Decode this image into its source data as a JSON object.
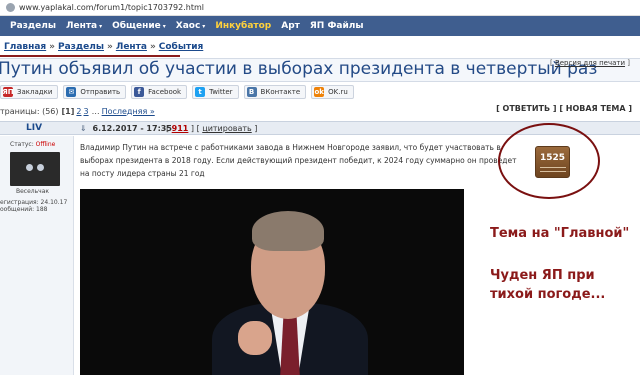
{
  "browser": {
    "url": "www.yaplakal.com/forum1/topic1703792.html"
  },
  "topnav": {
    "items": [
      "Разделы",
      "Лента",
      "Общение",
      "Хаос",
      "Инкубатор",
      "Арт",
      "ЯП Файлы"
    ],
    "dropdown_marker": "▾",
    "accent_color": "#3f5e8f",
    "highlight_color": "#ffd23c"
  },
  "breadcrumb": {
    "items": [
      "Главная",
      "Разделы",
      "Лента",
      "События"
    ],
    "separator": "»"
  },
  "topic": {
    "title": "Путин объявил об участии в выборах президента в четвертый раз",
    "print_link": "Версия для печати"
  },
  "social": [
    {
      "label": "Закладки",
      "icon": "yap-icon",
      "icon_text": "ЯП",
      "color": "#c62828"
    },
    {
      "label": "Отправить",
      "icon": "mail-icon",
      "icon_text": "✉",
      "color": "#2b6cb0"
    },
    {
      "label": "Facebook",
      "icon": "facebook-icon",
      "icon_text": "f",
      "color": "#3b5998"
    },
    {
      "label": "Twitter",
      "icon": "twitter-icon",
      "icon_text": "t",
      "color": "#1da1f2"
    },
    {
      "label": "ВКонтакте",
      "icon": "vk-icon",
      "icon_text": "B",
      "color": "#4a76a8"
    },
    {
      "label": "OK.ru",
      "icon": "ok-icon",
      "icon_text": "ok",
      "color": "#ee8208"
    }
  ],
  "pagination": {
    "prefix": "траницы: (56)",
    "current": "[1]",
    "pages": [
      "2",
      "3"
    ],
    "last": "Последняя »"
  },
  "actions": {
    "reply": "[ ОТВЕТИТЬ ]",
    "new_topic": "[ НОВАЯ ТЕМА ]"
  },
  "post": {
    "author": "LIV",
    "date": "6.12.2017 - 17:35",
    "votes": "911",
    "quote": "цитировать",
    "status_label": "Статус:",
    "status_value": "Offline",
    "rank": "Весельчак",
    "registration": "егистрация: 24.10.17",
    "messages": "ообщений: 188",
    "text": "Владимир Путин на встрече с работниками завода в Нижнем Новгороде заявил, что будет участвовать в выборах президента в 2018 году. Если действующий президент победит, к 2024 году суммарно он проведет на посту лидера страны 21 год",
    "rating": "1525"
  },
  "annotations": {
    "line1": "Тема на \"Главной\"",
    "line2": "Чуден ЯП при",
    "line3": "тихой погоде...",
    "color": "#8b1a1a"
  }
}
